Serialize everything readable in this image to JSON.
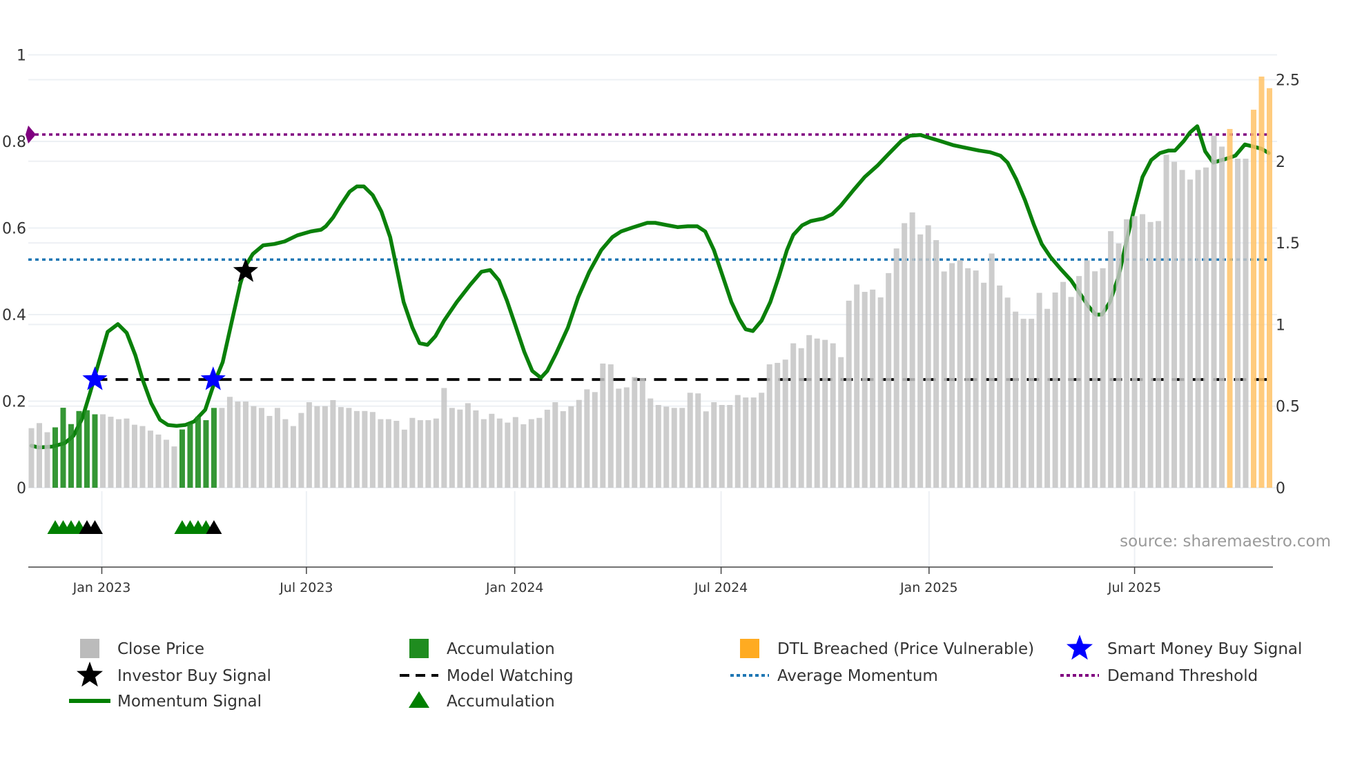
{
  "chart_data": {
    "type": "bar",
    "title": "",
    "source": "source: sharemaestro.com",
    "x_unit": "week index",
    "x_ticks": [
      {
        "label": "Jan 2023",
        "x": 8.87
      },
      {
        "label": "Jul 2023",
        "x": 34.65
      },
      {
        "label": "Jan 2024",
        "x": 60.9
      },
      {
        "label": "Jul 2024",
        "x": 86.9
      },
      {
        "label": "Jan 2025",
        "x": 113.1
      },
      {
        "label": "Jul 2025",
        "x": 139.0
      }
    ],
    "left_axis": {
      "range": [
        0,
        1
      ],
      "ticks": [
        "0",
        "0.2",
        "0.4",
        "0.6",
        "0.8",
        "1"
      ],
      "tick_values": [
        0,
        0.2,
        0.4,
        0.6,
        0.8,
        1
      ]
    },
    "right_axis": {
      "range": [
        0,
        2.5
      ],
      "ticks": [
        "0",
        "0.5",
        "1",
        "1.5",
        "2",
        "2.5"
      ],
      "tick_values": [
        0,
        0.5,
        1,
        1.5,
        2,
        2.5
      ]
    },
    "close_price": [
      0.365,
      0.396,
      0.34,
      0.37,
      0.49,
      0.39,
      0.47,
      0.475,
      0.45,
      0.45,
      0.435,
      0.42,
      0.424,
      0.386,
      0.378,
      0.35,
      0.326,
      0.294,
      0.253,
      0.357,
      0.393,
      0.435,
      0.414,
      0.489,
      0.489,
      0.557,
      0.528,
      0.528,
      0.5,
      0.489,
      0.44,
      0.489,
      0.42,
      0.378,
      0.458,
      0.524,
      0.5,
      0.5,
      0.537,
      0.494,
      0.489,
      0.47,
      0.47,
      0.464,
      0.42,
      0.42,
      0.41,
      0.356,
      0.428,
      0.414,
      0.414,
      0.424,
      0.611,
      0.489,
      0.479,
      0.518,
      0.474,
      0.42,
      0.453,
      0.424,
      0.399,
      0.433,
      0.389,
      0.42,
      0.428,
      0.478,
      0.524,
      0.469,
      0.499,
      0.538,
      0.603,
      0.586,
      0.761,
      0.756,
      0.607,
      0.615,
      0.678,
      0.672,
      0.547,
      0.507,
      0.497,
      0.489,
      0.489,
      0.582,
      0.578,
      0.468,
      0.524,
      0.507,
      0.507,
      0.568,
      0.553,
      0.553,
      0.582,
      0.756,
      0.765,
      0.785,
      0.885,
      0.855,
      0.935,
      0.914,
      0.906,
      0.885,
      0.8,
      1.146,
      1.245,
      1.2,
      1.214,
      1.166,
      1.315,
      1.466,
      1.621,
      1.687,
      1.552,
      1.608,
      1.517,
      1.325,
      1.376,
      1.394,
      1.345,
      1.331,
      1.256,
      1.435,
      1.239,
      1.165,
      1.079,
      1.035,
      1.035,
      1.194,
      1.096,
      1.196,
      1.261,
      1.169,
      1.297,
      1.393,
      1.326,
      1.345,
      1.572,
      1.497,
      1.645,
      1.664,
      1.676,
      1.628,
      1.634,
      2.04,
      1.997,
      1.947,
      1.888,
      1.947,
      1.962,
      2.157,
      2.09,
      2.198,
      2.016,
      2.016,
      2.316,
      2.519,
      2.448
    ],
    "accumulation_weeks": [
      3,
      4,
      5,
      6,
      7,
      8,
      19,
      20,
      21,
      22,
      23
    ],
    "dtl_breached_weeks": [
      151,
      154,
      155,
      156
    ],
    "momentum": [
      [
        0,
        0.097
      ],
      [
        0.9,
        0.093
      ],
      [
        2.6,
        0.095
      ],
      [
        4.2,
        0.103
      ],
      [
        5.3,
        0.12
      ],
      [
        6.4,
        0.16
      ],
      [
        7.4,
        0.22
      ],
      [
        8.5,
        0.29
      ],
      [
        9.6,
        0.36
      ],
      [
        10.9,
        0.378
      ],
      [
        12,
        0.358
      ],
      [
        13.1,
        0.306
      ],
      [
        14,
        0.25
      ],
      [
        15.1,
        0.195
      ],
      [
        16.2,
        0.157
      ],
      [
        17.2,
        0.145
      ],
      [
        18.3,
        0.143
      ],
      [
        19.4,
        0.145
      ],
      [
        20.5,
        0.153
      ],
      [
        21.9,
        0.18
      ],
      [
        23,
        0.24
      ],
      [
        24.1,
        0.29
      ],
      [
        25.2,
        0.38
      ],
      [
        26.3,
        0.47
      ],
      [
        27,
        0.513
      ],
      [
        27.9,
        0.54
      ],
      [
        29.2,
        0.56
      ],
      [
        30.6,
        0.563
      ],
      [
        31.9,
        0.569
      ],
      [
        33.5,
        0.583
      ],
      [
        35.2,
        0.592
      ],
      [
        36.5,
        0.596
      ],
      [
        37.1,
        0.604
      ],
      [
        38,
        0.624
      ],
      [
        39,
        0.654
      ],
      [
        40.1,
        0.684
      ],
      [
        41,
        0.696
      ],
      [
        41.9,
        0.696
      ],
      [
        43,
        0.676
      ],
      [
        44.1,
        0.638
      ],
      [
        45.2,
        0.579
      ],
      [
        46,
        0.509
      ],
      [
        46.9,
        0.429
      ],
      [
        48,
        0.37
      ],
      [
        48.9,
        0.334
      ],
      [
        49.9,
        0.33
      ],
      [
        50.9,
        0.35
      ],
      [
        52,
        0.386
      ],
      [
        53.6,
        0.429
      ],
      [
        55.3,
        0.469
      ],
      [
        56.7,
        0.499
      ],
      [
        57.8,
        0.503
      ],
      [
        58.9,
        0.479
      ],
      [
        59.9,
        0.433
      ],
      [
        61,
        0.374
      ],
      [
        62.1,
        0.314
      ],
      [
        63.1,
        0.27
      ],
      [
        64.2,
        0.254
      ],
      [
        65,
        0.27
      ],
      [
        66.1,
        0.31
      ],
      [
        67.6,
        0.37
      ],
      [
        68.9,
        0.44
      ],
      [
        70.3,
        0.499
      ],
      [
        71.8,
        0.549
      ],
      [
        73.2,
        0.579
      ],
      [
        74.3,
        0.592
      ],
      [
        75.9,
        0.602
      ],
      [
        77.6,
        0.612
      ],
      [
        78.6,
        0.612
      ],
      [
        79.7,
        0.608
      ],
      [
        81.4,
        0.602
      ],
      [
        82.7,
        0.604
      ],
      [
        83.9,
        0.604
      ],
      [
        84.9,
        0.592
      ],
      [
        86,
        0.549
      ],
      [
        87.1,
        0.489
      ],
      [
        88.2,
        0.429
      ],
      [
        89.2,
        0.39
      ],
      [
        90,
        0.366
      ],
      [
        90.9,
        0.362
      ],
      [
        92,
        0.386
      ],
      [
        93.1,
        0.429
      ],
      [
        94.2,
        0.489
      ],
      [
        95.2,
        0.549
      ],
      [
        96,
        0.584
      ],
      [
        97.1,
        0.606
      ],
      [
        98.2,
        0.616
      ],
      [
        99.8,
        0.622
      ],
      [
        100.9,
        0.632
      ],
      [
        102,
        0.652
      ],
      [
        103.6,
        0.688
      ],
      [
        105,
        0.718
      ],
      [
        106.6,
        0.744
      ],
      [
        108,
        0.771
      ],
      [
        109.6,
        0.801
      ],
      [
        110.7,
        0.813
      ],
      [
        112,
        0.815
      ],
      [
        113.4,
        0.807
      ],
      [
        114.5,
        0.801
      ],
      [
        116.2,
        0.791
      ],
      [
        117.8,
        0.785
      ],
      [
        119.4,
        0.779
      ],
      [
        120.8,
        0.775
      ],
      [
        122.1,
        0.767
      ],
      [
        123,
        0.751
      ],
      [
        124.1,
        0.712
      ],
      [
        125.2,
        0.664
      ],
      [
        126.3,
        0.608
      ],
      [
        127.3,
        0.563
      ],
      [
        128.4,
        0.533
      ],
      [
        129.7,
        0.505
      ],
      [
        131,
        0.479
      ],
      [
        132.1,
        0.449
      ],
      [
        133.2,
        0.419
      ],
      [
        134.1,
        0.4
      ],
      [
        134.9,
        0.4
      ],
      [
        135.9,
        0.429
      ],
      [
        137,
        0.489
      ],
      [
        138.1,
        0.579
      ],
      [
        139,
        0.648
      ],
      [
        140,
        0.718
      ],
      [
        141.1,
        0.757
      ],
      [
        142.2,
        0.773
      ],
      [
        143.3,
        0.779
      ],
      [
        144.1,
        0.779
      ],
      [
        145.2,
        0.801
      ],
      [
        146,
        0.821
      ],
      [
        146.9,
        0.835
      ],
      [
        147.9,
        0.777
      ],
      [
        148.9,
        0.751
      ],
      [
        150.4,
        0.759
      ],
      [
        151.7,
        0.767
      ],
      [
        152.9,
        0.793
      ],
      [
        154.2,
        0.787
      ],
      [
        155,
        0.783
      ],
      [
        155.9,
        0.773
      ]
    ],
    "model_watching": {
      "value": 0.25,
      "from_week": 8
    },
    "average_momentum": 0.527,
    "demand_threshold": 0.816,
    "smart_money_buy_signals": [
      [
        8,
        0.25
      ],
      [
        22.9,
        0.25
      ]
    ],
    "investor_buy_signals": [
      [
        27,
        0.5
      ]
    ],
    "accumulation_triangles": [
      3,
      4,
      5,
      6,
      19,
      20,
      21,
      22
    ],
    "signal_triangles": [
      7,
      8,
      23
    ],
    "legend": [
      {
        "label": "Close Price",
        "symbol": "square",
        "color": "#bbbbbb"
      },
      {
        "label": "Accumulation",
        "symbol": "square",
        "color": "#1f8c1f"
      },
      {
        "label": "DTL Breached (Price Vulnerable)",
        "symbol": "square",
        "color": "#ffab21"
      },
      {
        "label": "Smart Money Buy Signal",
        "symbol": "star",
        "color": "#0000ff"
      },
      {
        "label": "Investor Buy Signal",
        "symbol": "star",
        "color": "#000000"
      },
      {
        "label": "Model Watching",
        "symbol": "dash",
        "color": "#000000"
      },
      {
        "label": "Average Momentum",
        "symbol": "dot",
        "color": "#1f77b4"
      },
      {
        "label": "Demand Threshold",
        "symbol": "dot",
        "color": "#800080"
      },
      {
        "label": "Momentum Signal",
        "symbol": "line",
        "color": "#008000"
      },
      {
        "label": "Accumulation",
        "symbol": "triangle",
        "color": "#008000"
      }
    ],
    "grid": true,
    "legend_position": "bottom"
  }
}
